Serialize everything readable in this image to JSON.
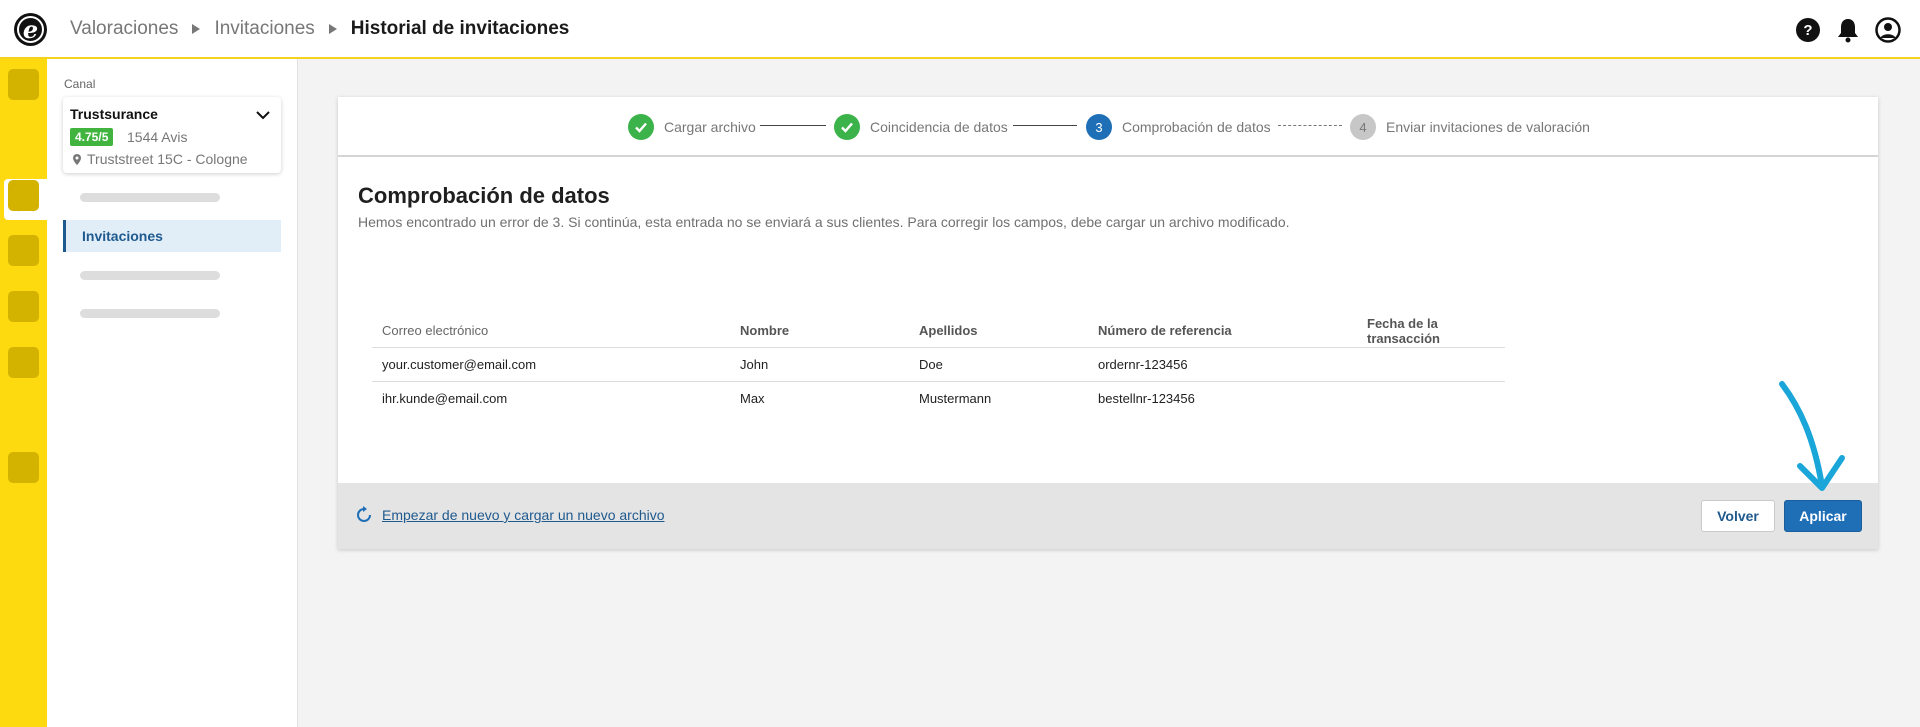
{
  "breadcrumb": {
    "items": [
      "Valoraciones",
      "Invitaciones"
    ],
    "current": "Historial de invitaciones"
  },
  "icons": {
    "help": "help-icon",
    "notifications": "bell-icon",
    "account": "user-icon",
    "star": "star-icon"
  },
  "sidebar": {
    "canal_label": "Canal",
    "channel": {
      "name": "Trustsurance",
      "score": "4.75/5",
      "reviews": "1544 Avis",
      "address": "Truststreet 15C - Cologne"
    },
    "active_item": "Invitaciones"
  },
  "stepper": {
    "steps": [
      {
        "number": "1",
        "label": "Cargar archivo",
        "state": "done"
      },
      {
        "number": "2",
        "label": "Coincidencia de datos",
        "state": "done"
      },
      {
        "number": "3",
        "label": "Comprobación de datos",
        "state": "current"
      },
      {
        "number": "4",
        "label": "Enviar invitaciones de valoración",
        "state": "pending"
      }
    ]
  },
  "main": {
    "title": "Comprobación de datos",
    "description": "Hemos encontrado un error de 3. Si continúa, esta entrada no se enviará a sus clientes. Para corregir los campos, debe cargar un archivo modificado."
  },
  "table": {
    "headers": [
      "Correo electrónico",
      "Nombre",
      "Apellidos",
      "Número de referencia",
      "Fecha de la transacción"
    ],
    "rows": [
      [
        "your.customer@email.com",
        "John",
        "Doe",
        "ordernr-123456",
        ""
      ],
      [
        "ihr.kunde@email.com",
        "Max",
        "Mustermann",
        "bestellnr-123456",
        ""
      ]
    ]
  },
  "footer": {
    "restart_label": "Empezar de nuevo y cargar un nuevo archivo",
    "back_label": "Volver",
    "apply_label": "Aplicar"
  },
  "colors": {
    "brand_yellow": "#fdd90f",
    "primary_blue": "#1f6fb7",
    "success_green": "#3cb34a",
    "annotation_cyan": "#1aa6d9"
  }
}
